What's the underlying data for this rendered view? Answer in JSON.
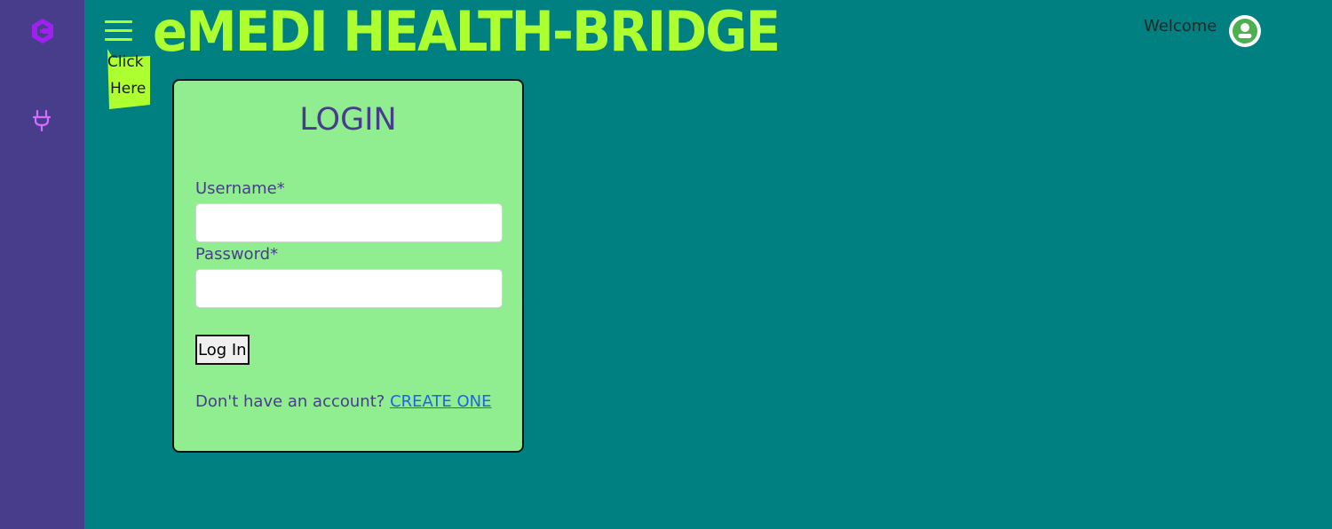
{
  "colors": {
    "background": "#008080",
    "sidebar": "#483d8b",
    "accent": "#adff2f",
    "card": "#90ee90",
    "heading_text": "#483d8b",
    "link": "#1e63e9",
    "icon": "#a020f0"
  },
  "sidebar": {
    "logo_icon": "c-logo-icon",
    "items": [
      {
        "icon": "plug-icon"
      }
    ]
  },
  "header": {
    "menu_icon": "hamburger-menu-icon",
    "hint_line1": "Click",
    "hint_line2": "Here",
    "title": "eMEDI HEALTH-BRIDGE",
    "welcome": "Welcome",
    "avatar_icon": "user-avatar-icon"
  },
  "login": {
    "heading": "LOGIN",
    "username_label": "Username*",
    "username_value": "",
    "password_label": "Password*",
    "password_value": "",
    "submit_label": "Log In",
    "signup_prompt": "Don't have an account?",
    "signup_link": "CREATE ONE"
  }
}
